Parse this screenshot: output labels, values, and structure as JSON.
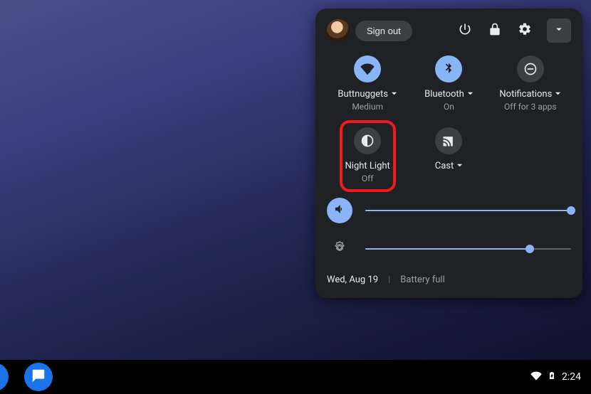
{
  "header": {
    "signout_label": "Sign out"
  },
  "tiles": {
    "wifi": {
      "label": "Buttnuggets",
      "sub": "Medium",
      "has_caret": true,
      "active": true
    },
    "bt": {
      "label": "Bluetooth",
      "sub": "On",
      "has_caret": true,
      "active": true
    },
    "notif": {
      "label": "Notifications",
      "sub": "Off for 3 apps",
      "has_caret": true,
      "active": false
    },
    "night": {
      "label": "Night Light",
      "sub": "Off",
      "has_caret": false,
      "active": false,
      "highlighted": true
    },
    "cast": {
      "label": "Cast",
      "sub": "",
      "has_caret": true,
      "active": false
    }
  },
  "sliders": {
    "volume": {
      "percent": 100
    },
    "brightness": {
      "percent": 80
    }
  },
  "footer": {
    "date": "Wed, Aug 19",
    "battery": "Battery full"
  },
  "shelf": {
    "clock": "2:24"
  },
  "colors": {
    "accent": "#8ab4f8",
    "panel_bg": "#202124",
    "highlight": "#f21b1b"
  }
}
